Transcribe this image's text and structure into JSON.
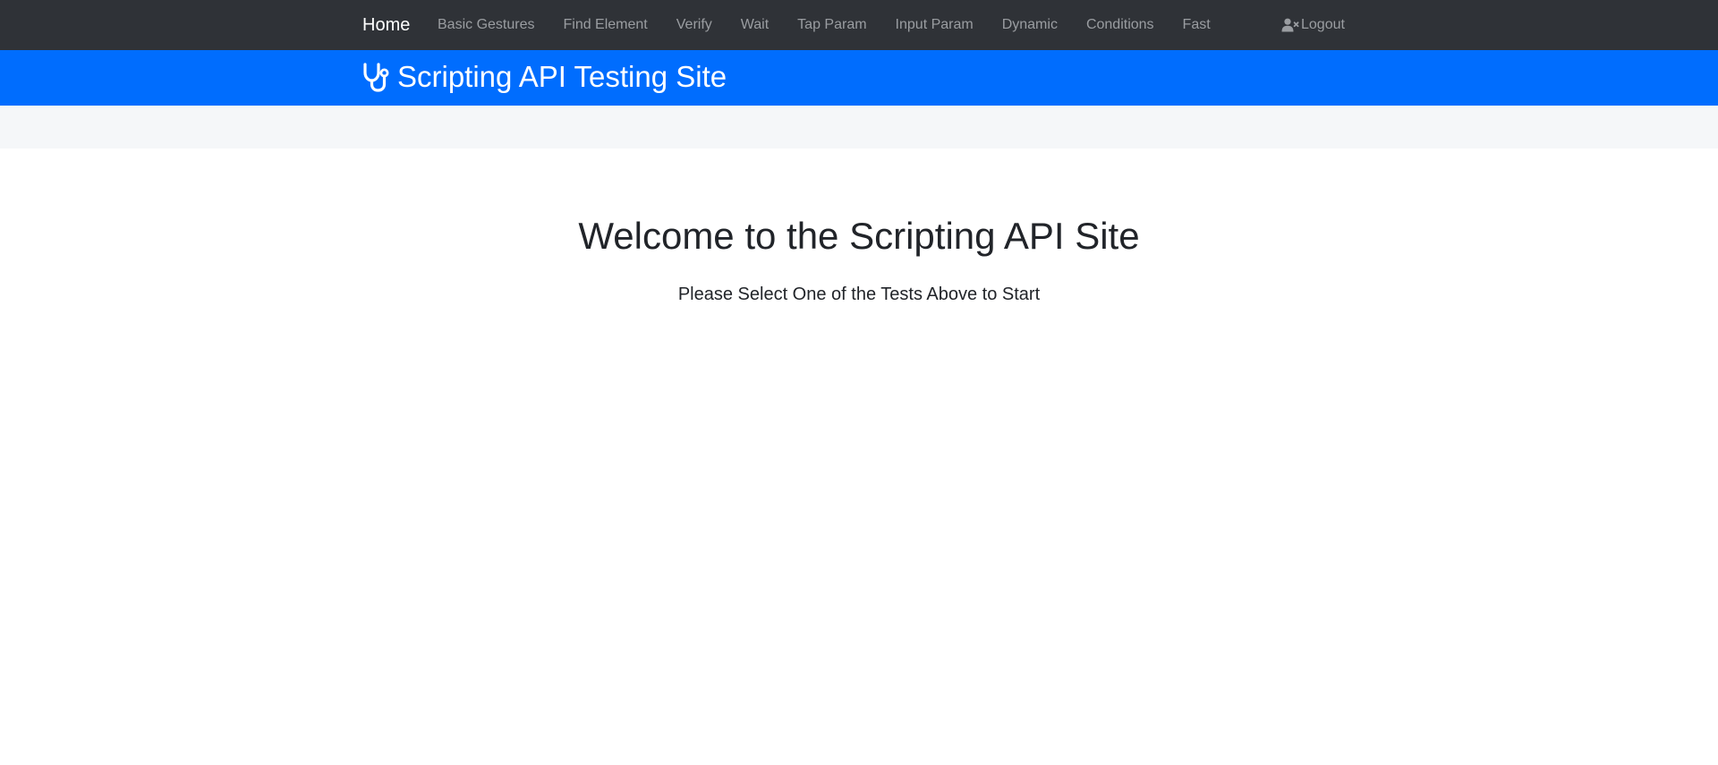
{
  "nav": {
    "brand": "Home",
    "links": [
      {
        "label": "Basic Gestures",
        "name": "nav-link-basic-gestures"
      },
      {
        "label": "Find Element",
        "name": "nav-link-find-element"
      },
      {
        "label": "Verify",
        "name": "nav-link-verify"
      },
      {
        "label": "Wait",
        "name": "nav-link-wait"
      },
      {
        "label": "Tap Param",
        "name": "nav-link-tap-param"
      },
      {
        "label": "Input Param",
        "name": "nav-link-input-param"
      },
      {
        "label": "Dynamic",
        "name": "nav-link-dynamic"
      },
      {
        "label": "Conditions",
        "name": "nav-link-conditions"
      },
      {
        "label": "Fast",
        "name": "nav-link-fast"
      }
    ],
    "logout_label": "Logout",
    "logout_icon": "user-times-icon"
  },
  "banner": {
    "icon": "stethoscope-icon",
    "title": "Scripting API Testing Site"
  },
  "main": {
    "heading": "Welcome to the Scripting API Site",
    "lead": "Please Select One of the Tests Above to Start"
  },
  "colors": {
    "navbar_bg": "#2f3237",
    "banner_bg": "#006dfe",
    "subbar_bg": "#f5f7f9",
    "nav_link": "#9a9da1",
    "text": "#212429"
  }
}
